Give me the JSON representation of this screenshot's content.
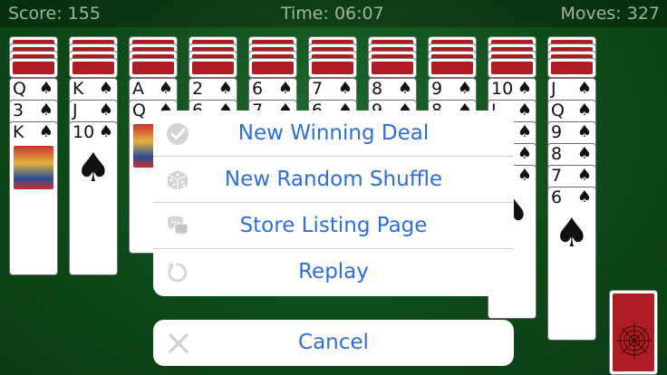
{
  "status": {
    "score": "Score:  155",
    "time": "Time:  06:07",
    "moves": "Moves:  327"
  },
  "tableau": [
    {
      "backs": 4,
      "cards": [
        {
          "rank": "Q",
          "suit": "♠"
        },
        {
          "rank": "3",
          "suit": "♠"
        },
        {
          "rank": "K",
          "suit": "♠",
          "face": true
        }
      ]
    },
    {
      "backs": 4,
      "cards": [
        {
          "rank": "K",
          "suit": "♠"
        },
        {
          "rank": "J",
          "suit": "♠"
        },
        {
          "rank": "10",
          "suit": "♠",
          "big": true
        }
      ]
    },
    {
      "backs": 4,
      "cards": [
        {
          "rank": "A",
          "suit": "♠"
        },
        {
          "rank": "Q",
          "suit": "♠",
          "face": true
        }
      ]
    },
    {
      "backs": 4,
      "cards": [
        {
          "rank": "2",
          "suit": "♠"
        },
        {
          "rank": "6",
          "suit": "♠"
        }
      ]
    },
    {
      "backs": 4,
      "cards": [
        {
          "rank": "6",
          "suit": "♠"
        },
        {
          "rank": "7",
          "suit": "♠"
        }
      ]
    },
    {
      "backs": 4,
      "cards": [
        {
          "rank": "7",
          "suit": "♠"
        },
        {
          "rank": "6",
          "suit": "♠"
        }
      ]
    },
    {
      "backs": 4,
      "cards": [
        {
          "rank": "8",
          "suit": "♠"
        },
        {
          "rank": "9",
          "suit": "♠"
        }
      ]
    },
    {
      "backs": 4,
      "cards": [
        {
          "rank": "9",
          "suit": "♠"
        },
        {
          "rank": "8",
          "suit": "♠"
        }
      ]
    },
    {
      "backs": 4,
      "cards": [
        {
          "rank": "10",
          "suit": "♠"
        },
        {
          "rank": "J",
          "suit": "♠"
        },
        {
          "rank": "",
          "suit": "♠"
        },
        {
          "rank": "",
          "suit": "♠"
        },
        {
          "rank": "",
          "suit": "♠",
          "big": true
        }
      ]
    },
    {
      "backs": 4,
      "cards": [
        {
          "rank": "J",
          "suit": "♠"
        },
        {
          "rank": "Q",
          "suit": "♠"
        },
        {
          "rank": "9",
          "suit": "♠"
        },
        {
          "rank": "8",
          "suit": "♠"
        },
        {
          "rank": "7",
          "suit": "♠"
        },
        {
          "rank": "6",
          "suit": "♠",
          "big": true
        }
      ]
    }
  ],
  "menu": {
    "items": [
      {
        "label": "New Winning Deal",
        "icon": "checkmark-icon"
      },
      {
        "label": "New Random Shuffle",
        "icon": "dice-icon"
      },
      {
        "label": "Store Listing Page",
        "icon": "chat-bubbles-icon"
      },
      {
        "label": "Replay",
        "icon": "replay-icon"
      }
    ],
    "cancel": {
      "label": "Cancel",
      "icon": "close-icon"
    }
  },
  "colors": {
    "felt": "#0f4a1a",
    "card_back": "#b01c24",
    "action_text": "#2e6ed6",
    "icon": "#c8c8c8"
  }
}
